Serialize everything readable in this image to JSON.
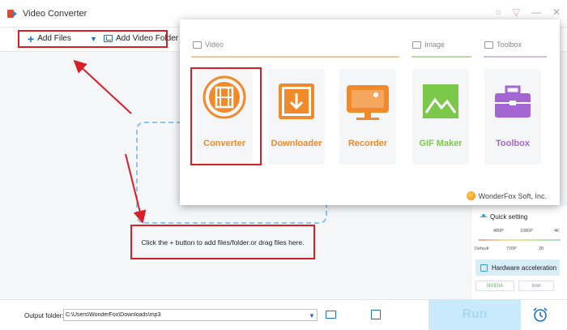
{
  "window": {
    "title": "Video Converter"
  },
  "toolbar": {
    "add_files": "Add Files",
    "add_folder": "Add Video Folder"
  },
  "workspace": {
    "drop_message": "Click the + button to add files/folder.or drag files here."
  },
  "popup": {
    "categories": {
      "video": "Video",
      "image": "Image",
      "toolbox": "Toolbox"
    },
    "tiles": [
      {
        "label": "Converter",
        "icon": "film-reel-icon",
        "color": "#f08a2a"
      },
      {
        "label": "Downloader",
        "icon": "download-icon",
        "color": "#f08a2a"
      },
      {
        "label": "Recorder",
        "icon": "screen-record-icon",
        "color": "#f08a2a"
      },
      {
        "label": "GIF Maker",
        "icon": "image-icon",
        "color": "#7cc84a"
      },
      {
        "label": "Toolbox",
        "icon": "toolbox-icon",
        "color": "#a466d2"
      }
    ],
    "brand": "WonderFox Soft, Inc."
  },
  "settings": {
    "quick_setting": "Quick setting",
    "top_labels": [
      "480P",
      "1080P",
      "4K"
    ],
    "bottom_labels": [
      "Default",
      "720P",
      "2K"
    ],
    "hw_accel": "Hardware acceleration",
    "vendors": [
      "NVIDIA",
      "Intel"
    ]
  },
  "bottom": {
    "output_label": "Output folder:",
    "output_path": "C:\\Users\\WonderFox\\Downloads\\mp3",
    "run": "Run"
  },
  "colors": {
    "accent": "#1a6fd6",
    "annotation": "#d91f26",
    "video": "#f08a2a",
    "image": "#7cc84a",
    "toolbox": "#a466d2"
  }
}
